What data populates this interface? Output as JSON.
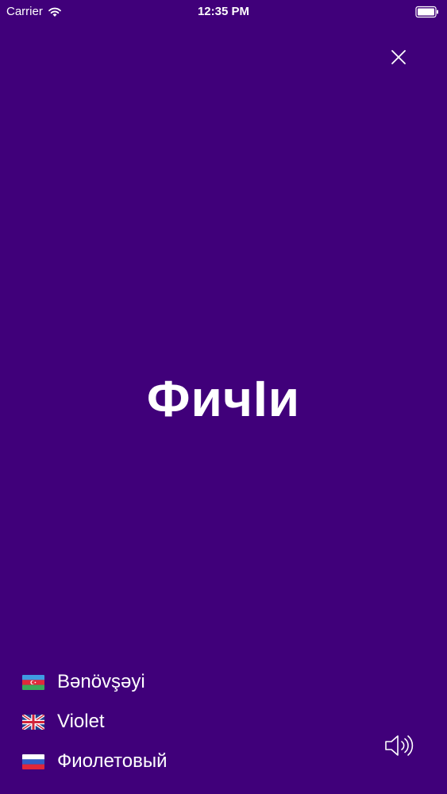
{
  "status_bar": {
    "carrier": "Carrier",
    "time": "12:35 PM"
  },
  "icons": {
    "wifi": "wifi-icon",
    "battery": "battery-icon",
    "close": "close-icon",
    "speaker": "speaker-icon"
  },
  "colors": {
    "background": "#40007a",
    "text": "#ffffff"
  },
  "word": "ФичӀи",
  "translations": [
    {
      "flag": "azerbaijan-flag-icon",
      "text": "Bənövşəyi"
    },
    {
      "flag": "uk-flag-icon",
      "text": "Violet"
    },
    {
      "flag": "russia-flag-icon",
      "text": "Фиолетовый"
    }
  ]
}
